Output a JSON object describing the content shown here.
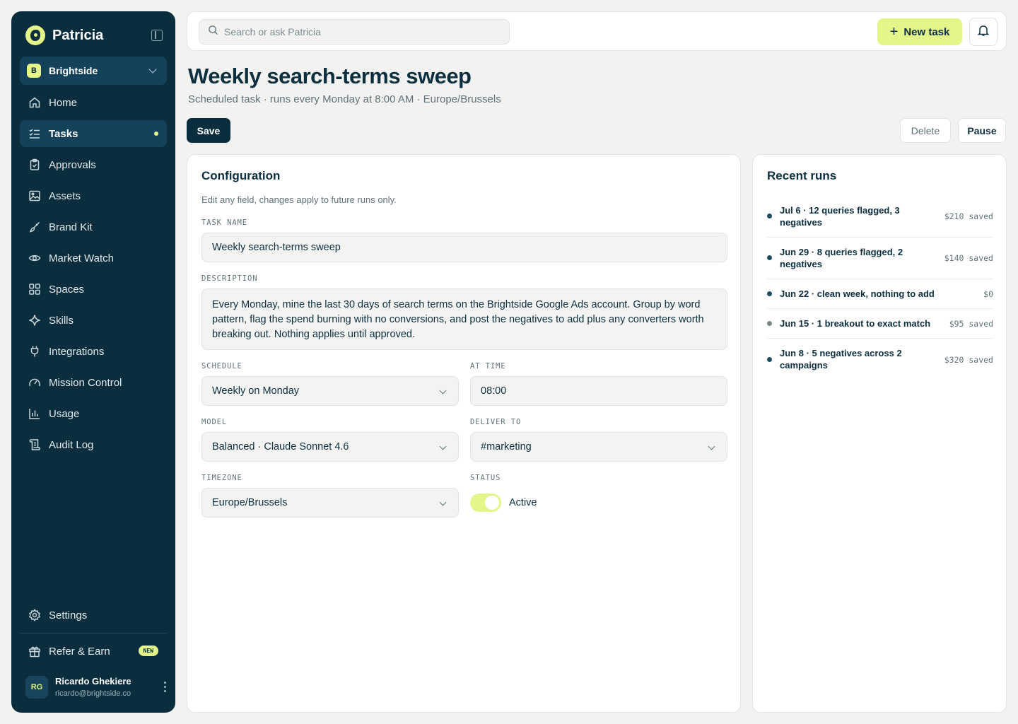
{
  "app": {
    "name": "Patricia"
  },
  "workspace": {
    "badge": "B",
    "name": "Brightside"
  },
  "nav": [
    {
      "label": "Home",
      "icon": "home-icon"
    },
    {
      "label": "Tasks",
      "icon": "tasks-icon",
      "active": true
    },
    {
      "label": "Approvals",
      "icon": "clipboard-icon"
    },
    {
      "label": "Assets",
      "icon": "image-icon"
    },
    {
      "label": "Brand Kit",
      "icon": "brush-icon"
    },
    {
      "label": "Market Watch",
      "icon": "eye-icon"
    },
    {
      "label": "Spaces",
      "icon": "grid-icon"
    },
    {
      "label": "Skills",
      "icon": "sparkle-icon"
    },
    {
      "label": "Integrations",
      "icon": "plug-icon"
    },
    {
      "label": "Mission Control",
      "icon": "gauge-icon"
    },
    {
      "label": "Usage",
      "icon": "bar-chart-icon"
    },
    {
      "label": "Audit Log",
      "icon": "scroll-icon"
    }
  ],
  "settings": {
    "label": "Settings",
    "icon": "gear-icon"
  },
  "refer": {
    "label": "Refer & Earn",
    "badge": "NEW",
    "icon": "gift-icon"
  },
  "user": {
    "initials": "RG",
    "name": "Ricardo Ghekiere",
    "email": "ricardo@brightside.co"
  },
  "topbar": {
    "search_placeholder": "Search or ask Patricia",
    "new_task": "New task"
  },
  "page": {
    "title": "Weekly search-terms sweep",
    "subtitle": "Scheduled task · runs every Monday at 8:00 AM · Europe/Brussels",
    "save": "Save",
    "delete": "Delete",
    "pause": "Pause"
  },
  "config": {
    "title": "Configuration",
    "subtitle": "Edit any field, changes apply to future runs only.",
    "task_name_label": "TASK NAME",
    "task_name": "Weekly search-terms sweep",
    "description_label": "DESCRIPTION",
    "description": "Every Monday, mine the last 30 days of search terms on the Brightside Google Ads account. Group by word pattern, flag the spend burning with no conversions, and post the negatives to add plus any converters worth breaking out. Nothing applies until approved.",
    "schedule_label": "SCHEDULE",
    "schedule": "Weekly on Monday",
    "time_label": "AT TIME",
    "time": "08:00",
    "model_label": "MODEL",
    "model": "Balanced · Claude Sonnet 4.6",
    "deliver_label": "DELIVER TO",
    "deliver": "#marketing",
    "timezone_label": "TIMEZONE",
    "timezone": "Europe/Brussels",
    "status_label": "STATUS",
    "status": "Active",
    "status_on": true
  },
  "runs": {
    "title": "Recent runs",
    "items": [
      {
        "text": "Jul 6 · 12 queries flagged, 3 negatives",
        "amount": "$210 saved",
        "dot": "#1f4c5f"
      },
      {
        "text": "Jun 29 · 8 queries flagged, 2 negatives",
        "amount": "$140 saved",
        "dot": "#1f4c5f"
      },
      {
        "text": "Jun 22 · clean week, nothing to add",
        "amount": "$0",
        "dot": "#1f4c5f"
      },
      {
        "text": "Jun 15 · 1 breakout to exact match",
        "amount": "$95 saved",
        "dot": "#7a8588"
      },
      {
        "text": "Jun 8 · 5 negatives across 2 campaigns",
        "amount": "$320 saved",
        "dot": "#1f4c5f"
      }
    ]
  },
  "colors": {
    "sidebar": "#0b2e3e",
    "accent": "#e4f58a",
    "text": "#0c2f3f"
  }
}
